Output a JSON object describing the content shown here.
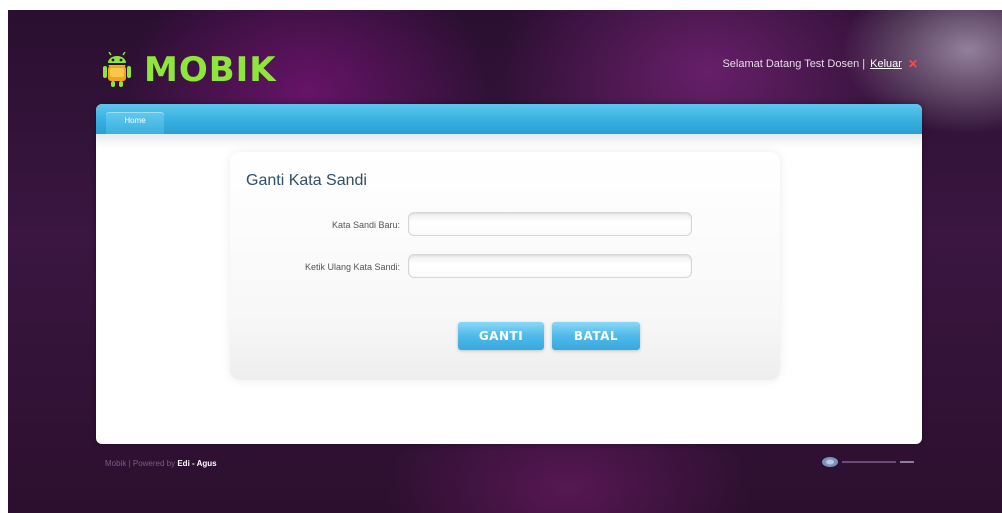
{
  "header": {
    "logo_text": "MOBIK",
    "welcome_text": "Selamat Datang Test Dosen |",
    "logout_label": "Keluar",
    "logout_icon": "close-icon",
    "logo_icon": "android-icon"
  },
  "nav": {
    "tabs": [
      {
        "label": "Home"
      }
    ]
  },
  "form": {
    "title": "Ganti Kata Sandi",
    "fields": [
      {
        "label": "Kata Sandi Baru:",
        "value": "",
        "placeholder": ""
      },
      {
        "label": "Ketik Ulang Kata Sandi:",
        "value": "",
        "placeholder": ""
      }
    ],
    "submit_label": "GANTI",
    "cancel_label": "BATAL"
  },
  "footer": {
    "left_text": "Mobik | Powered by",
    "authors": "Edi - Agus"
  },
  "colors": {
    "accent_blue": "#38a8de",
    "logo_green": "#8ee63a",
    "background_purple": "#3a1640"
  }
}
